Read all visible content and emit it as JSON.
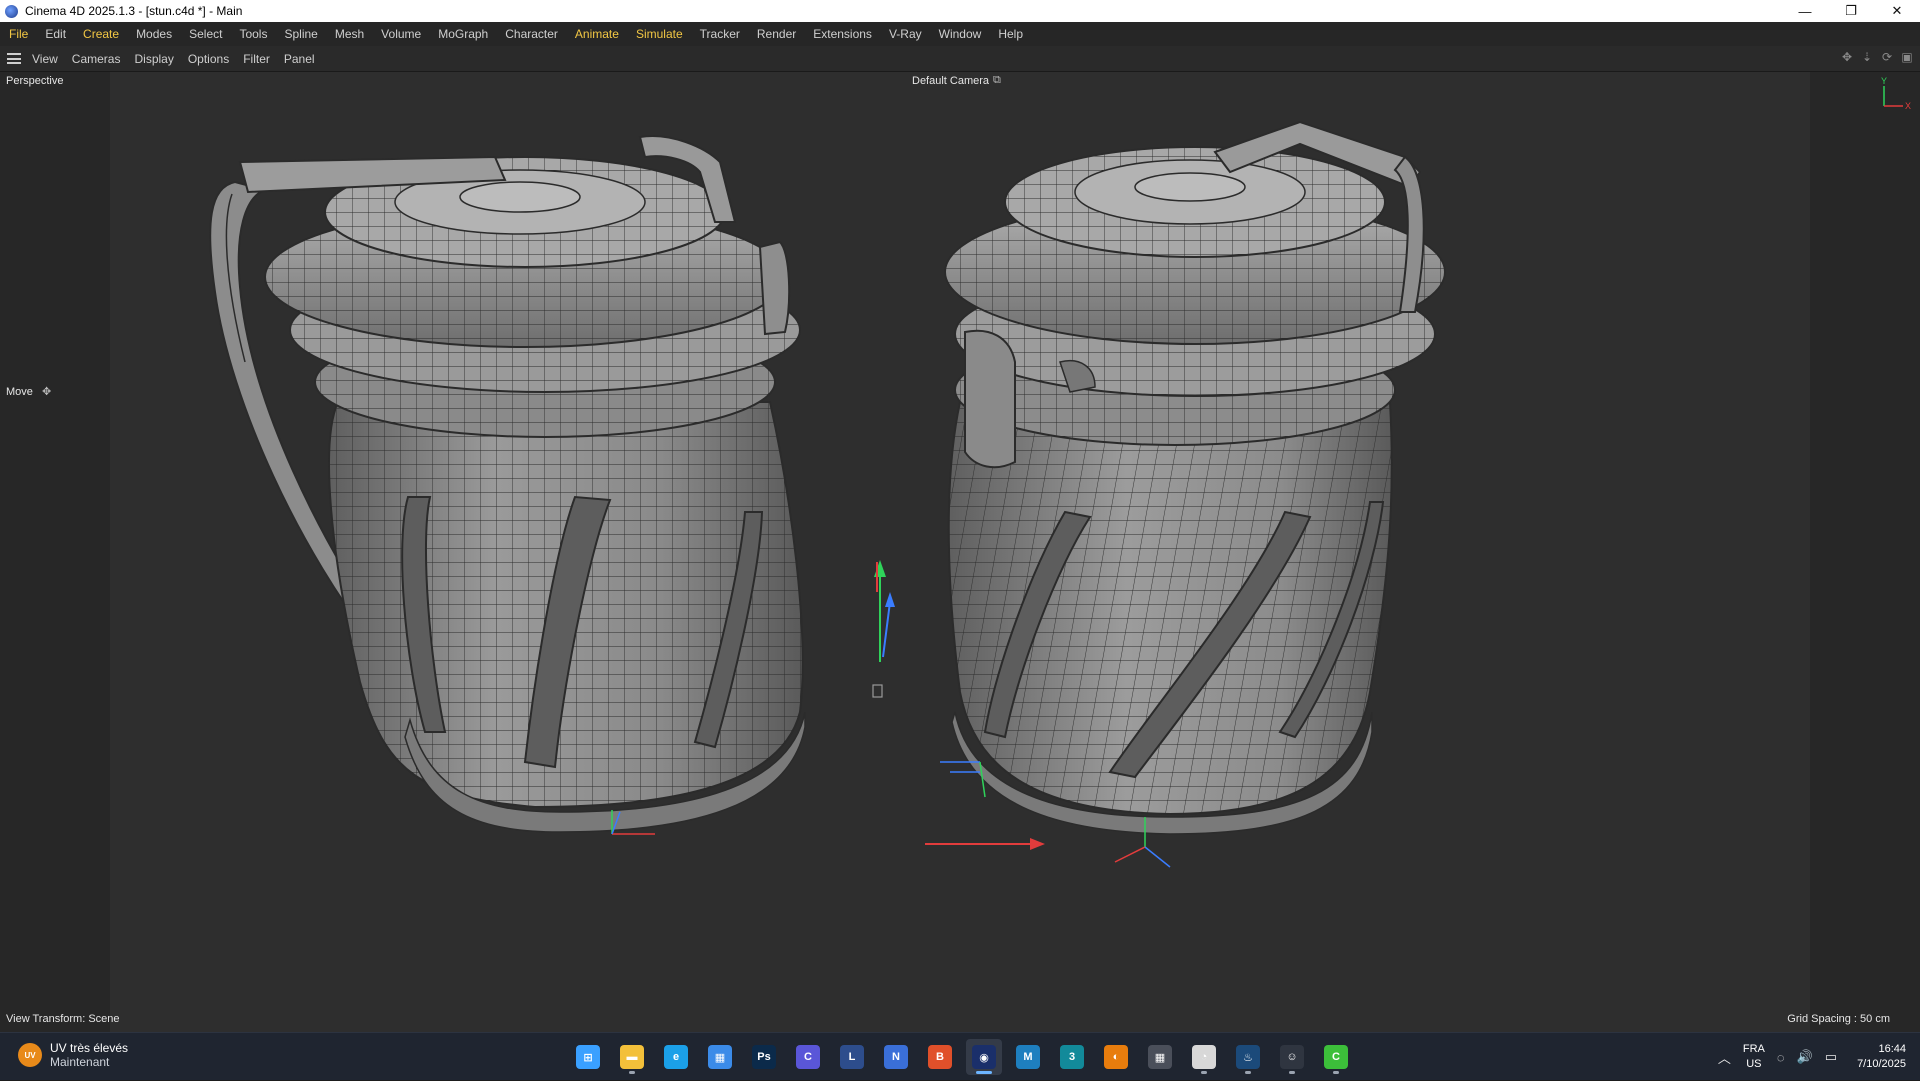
{
  "window": {
    "title": "Cinema 4D 2025.1.3 - [stun.c4d *] - Main",
    "controls": [
      "—",
      "❐",
      "✕"
    ]
  },
  "menubar": {
    "items": [
      {
        "label": "File",
        "highlight": true
      },
      {
        "label": "Edit",
        "highlight": false
      },
      {
        "label": "Create",
        "highlight": true
      },
      {
        "label": "Modes",
        "highlight": false
      },
      {
        "label": "Select",
        "highlight": false
      },
      {
        "label": "Tools",
        "highlight": false
      },
      {
        "label": "Spline",
        "highlight": false
      },
      {
        "label": "Mesh",
        "highlight": false
      },
      {
        "label": "Volume",
        "highlight": false
      },
      {
        "label": "MoGraph",
        "highlight": false
      },
      {
        "label": "Character",
        "highlight": false
      },
      {
        "label": "Animate",
        "highlight": true
      },
      {
        "label": "Simulate",
        "highlight": true
      },
      {
        "label": "Tracker",
        "highlight": false
      },
      {
        "label": "Render",
        "highlight": false
      },
      {
        "label": "Extensions",
        "highlight": false
      },
      {
        "label": "V-Ray",
        "highlight": false
      },
      {
        "label": "Window",
        "highlight": false
      },
      {
        "label": "Help",
        "highlight": false
      }
    ]
  },
  "viewbar": {
    "items": [
      "View",
      "Cameras",
      "Display",
      "Options",
      "Filter",
      "Panel"
    ]
  },
  "viewport": {
    "mode": "Perspective",
    "camera": "Default Camera",
    "tool": "Move",
    "view_transform": "View Transform: Scene",
    "grid_spacing": "Grid Spacing : 50 cm",
    "axis_y": "Y",
    "axis_x": "X"
  },
  "taskbar": {
    "weather_badge": "UV",
    "weather_title": "UV très élevés",
    "weather_sub": "Maintenant",
    "apps": [
      {
        "name": "start",
        "icon": "windows-icon",
        "glyph": "⊞",
        "color": "#3aa0ff",
        "running": false
      },
      {
        "name": "file-explorer",
        "icon": "folder-icon",
        "glyph": "▬",
        "color": "#f3c03a",
        "running": true
      },
      {
        "name": "edge",
        "icon": "edge-icon",
        "glyph": "e",
        "color": "#1ba0e8",
        "running": false
      },
      {
        "name": "store",
        "icon": "store-icon",
        "glyph": "▦",
        "color": "#3b8be8",
        "running": false
      },
      {
        "name": "photoshop",
        "icon": "photoshop-icon",
        "glyph": "Ps",
        "color": "#0b2a4a",
        "running": false
      },
      {
        "name": "app-c",
        "icon": "app-c-icon",
        "glyph": "C",
        "color": "#5a56d8",
        "running": false
      },
      {
        "name": "app-l",
        "icon": "app-l-icon",
        "glyph": "L",
        "color": "#2d4d8c",
        "running": false
      },
      {
        "name": "app-n",
        "icon": "app-n-icon",
        "glyph": "N",
        "color": "#3a6fd8",
        "running": false
      },
      {
        "name": "brave",
        "icon": "brave-icon",
        "glyph": "B",
        "color": "#e0502a",
        "running": false
      },
      {
        "name": "cinema4d",
        "icon": "cinema4d-icon",
        "glyph": "◉",
        "color": "#1a2f6a",
        "running": true,
        "active": true
      },
      {
        "name": "app-m",
        "icon": "app-m-icon",
        "glyph": "M",
        "color": "#1e7fbf",
        "running": false
      },
      {
        "name": "3dsmax",
        "icon": "3dsmax-icon",
        "glyph": "3",
        "color": "#128a9a",
        "running": false
      },
      {
        "name": "blender",
        "icon": "blender-icon",
        "glyph": "◐",
        "color": "#e87d0d",
        "running": false
      },
      {
        "name": "calculator",
        "icon": "calculator-icon",
        "glyph": "▦",
        "color": "#4a4f5a",
        "running": false
      },
      {
        "name": "app-clock",
        "icon": "clock-icon",
        "glyph": "◔",
        "color": "#d8d8d8",
        "running": true
      },
      {
        "name": "steam",
        "icon": "steam-icon",
        "glyph": "♨",
        "color": "#1b4a7a",
        "running": true
      },
      {
        "name": "app-person",
        "icon": "person-icon",
        "glyph": "☺",
        "color": "#2f3540",
        "running": true
      },
      {
        "name": "app-green",
        "icon": "app-green-icon",
        "glyph": "C",
        "color": "#3cbf3a",
        "running": true
      }
    ],
    "lang_top": "FRA",
    "lang_bottom": "US",
    "time": "16:44",
    "date": "7/10/2025"
  }
}
